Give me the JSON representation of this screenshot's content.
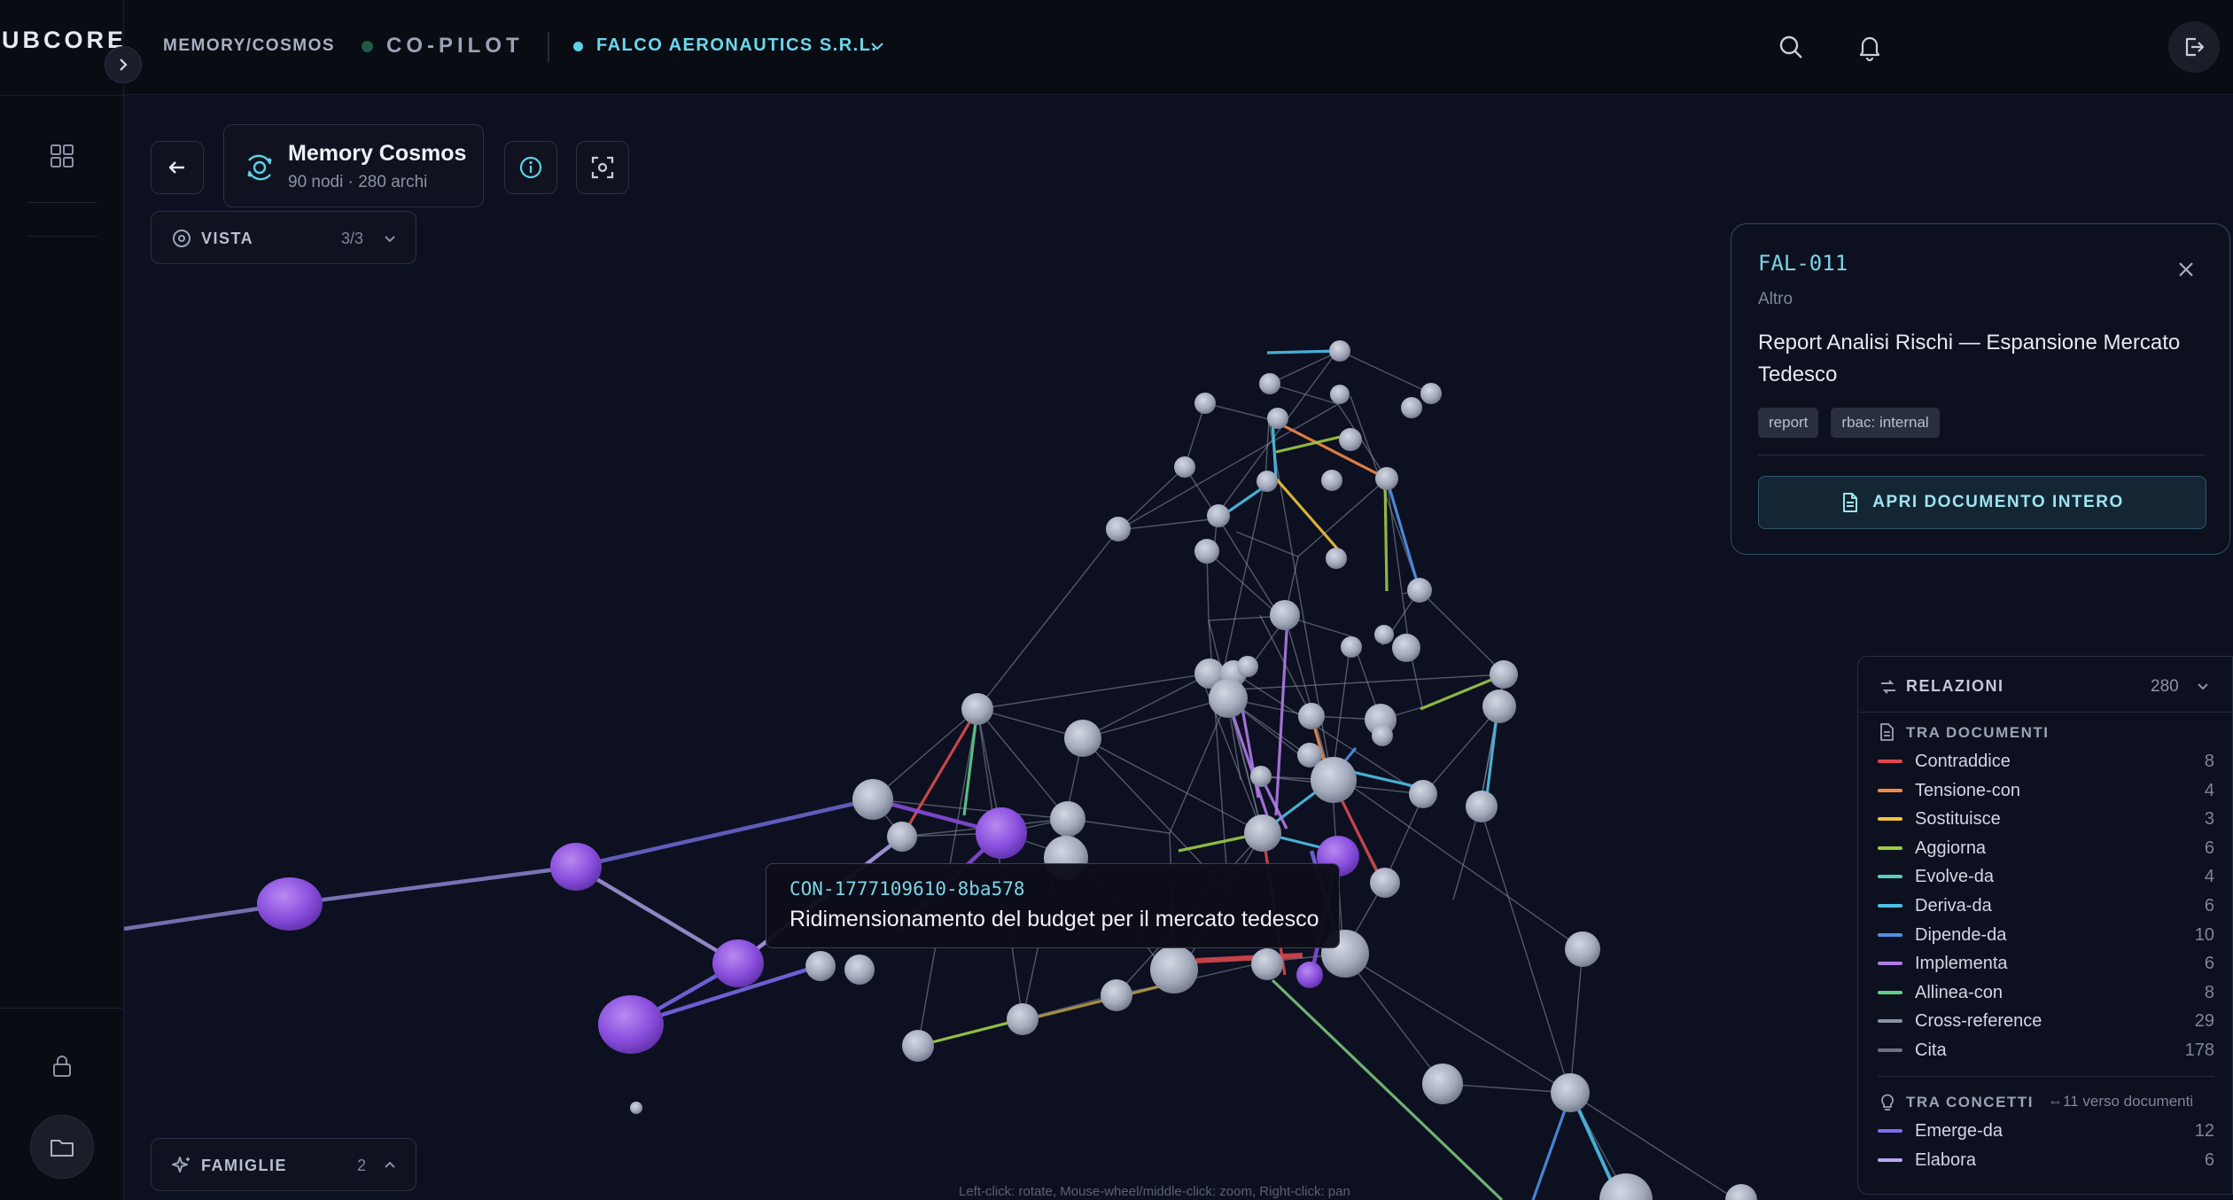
{
  "brand": "UBCORE",
  "topbar": {
    "breadcrumb": "MEMORY/COSMOS",
    "copilot_label": "CO-PILOT",
    "org_name": "FALCO AERONAUTICS S.R.L."
  },
  "toolbar": {
    "title": "Memory Cosmos",
    "subtitle": "90 nodi · 280 archi",
    "vista_label": "VISTA",
    "vista_count": "3/3",
    "famiglie_label": "FAMIGLIE",
    "famiglie_count": "2"
  },
  "tooltip": {
    "id": "CON-1777109610-8ba578",
    "text": "Ridimensionamento del budget per il mercato tedesco"
  },
  "hint": "Left-click: rotate, Mouse-wheel/middle-click: zoom, Right-click: pan",
  "detail": {
    "code": "FAL-011",
    "type": "Altro",
    "title": "Report Analisi Rischi — Espansione Mercato Tedesco",
    "tags": [
      "report",
      "rbac: internal"
    ],
    "open_label": "APRI DOCUMENTO INTERO"
  },
  "legend": {
    "title": "RELAZIONI",
    "total": "280",
    "section_docs": "TRA DOCUMENTI",
    "docs": [
      {
        "name": "Contraddice",
        "count": "8",
        "color": "#e0474c"
      },
      {
        "name": "Tensione-con",
        "count": "4",
        "color": "#f0894a"
      },
      {
        "name": "Sostituisce",
        "count": "3",
        "color": "#f2c43e"
      },
      {
        "name": "Aggiorna",
        "count": "6",
        "color": "#9ccc45"
      },
      {
        "name": "Evolve-da",
        "count": "4",
        "color": "#57cfc4"
      },
      {
        "name": "Deriva-da",
        "count": "6",
        "color": "#4fc0e8"
      },
      {
        "name": "Dipende-da",
        "count": "10",
        "color": "#4f8fe6"
      },
      {
        "name": "Implementa",
        "count": "6",
        "color": "#b07ce8"
      },
      {
        "name": "Allinea-con",
        "count": "8",
        "color": "#5ecf8a"
      },
      {
        "name": "Cross-reference",
        "count": "29",
        "color": "#8a92a5"
      },
      {
        "name": "Cita",
        "count": "178",
        "color": "#6b7285"
      }
    ],
    "section_concepts": "TRA CONCETTI",
    "concepts_note": "⇔11 verso documenti",
    "concepts": [
      {
        "name": "Emerge-da",
        "count": "12",
        "color": "#7b6ff0"
      },
      {
        "name": "Elabora",
        "count": "6",
        "color": "#b9a3f5"
      }
    ]
  },
  "colors": {
    "accent": "#5ad3e6",
    "node_doc": "#a9b0c4",
    "node_concept": "#8c4fe0"
  }
}
